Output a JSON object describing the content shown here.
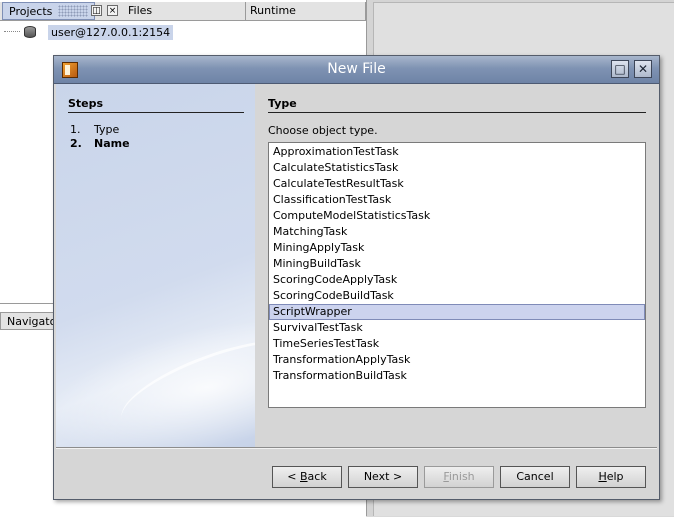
{
  "ide": {
    "tabs": [
      "Projects",
      "Files",
      "Runtime"
    ],
    "tab_buttons": {
      "restore": "◫",
      "close": "×"
    },
    "tree_node": "user@127.0.0.1:2154",
    "navigator_tab": "Navigator"
  },
  "dialog": {
    "title": "New File",
    "title_buttons": {
      "maximize": "□",
      "close": "✕"
    },
    "steps": {
      "heading": "Steps",
      "items": [
        {
          "num": "1.",
          "label": "Type",
          "current": false
        },
        {
          "num": "2.",
          "label": "Name",
          "current": true
        }
      ]
    },
    "type": {
      "heading": "Type",
      "instruction": "Choose object type.",
      "selected": "ScriptWrapper",
      "items": [
        "ApproximationTestTask",
        "CalculateStatisticsTask",
        "CalculateTestResultTask",
        "ClassificationTestTask",
        "ComputeModelStatisticsTask",
        "MatchingTask",
        "MiningApplyTask",
        "MiningBuildTask",
        "ScoringCodeApplyTask",
        "ScoringCodeBuildTask",
        "ScriptWrapper",
        "SurvivalTestTask",
        "TimeSeriesTestTask",
        "TransformationApplyTask",
        "TransformationBuildTask"
      ]
    },
    "buttons": {
      "back": {
        "pre": "< ",
        "mnemonic": "B",
        "post": "ack"
      },
      "next": "Next >",
      "finish": {
        "mnemonic": "F",
        "post": "inish",
        "enabled": false
      },
      "cancel": "Cancel",
      "help": {
        "mnemonic": "H",
        "post": "elp"
      }
    }
  },
  "colors": {
    "selection": "#ccd3ee",
    "titlebar": "#7f93b3",
    "steps_bg": "#c9d5ea"
  }
}
